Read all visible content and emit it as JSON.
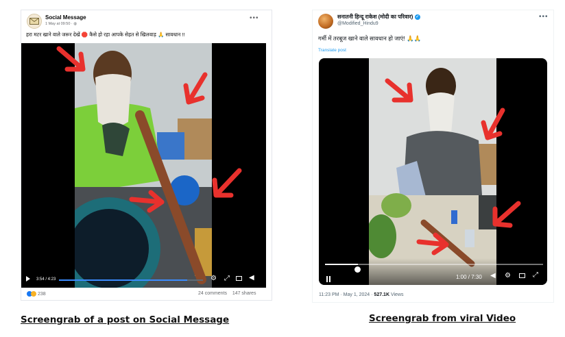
{
  "left_post": {
    "page_name": "Social Message",
    "meta": "1 May at 09:50 · ",
    "caption": "हरा मटर खाने वाले जरूर देखें 🛑 कैसे हो रहा आपके सेहत से खिलवाड़ 🙏 सावधान !!",
    "video": {
      "time_display": "3:54 / 4:23",
      "progress_fraction": 0.89
    },
    "reactions_count": "238",
    "comments": "24 comments",
    "shares": "147 shares"
  },
  "right_post": {
    "display_name": "सनातनी हिन्दू राकेश (मोदी का परिवार)",
    "handle": "@Modified_Hindu9",
    "text": "गर्मी में तरबूज खाने वाले सावधान हो जाएं! 🙏🙏",
    "translate_label": "Translate post",
    "video": {
      "time_display": "1:00 / 7:30",
      "progress_fraction": 0.15
    },
    "timestamp": "11:23 PM · May 1, 2024 · ",
    "views_count": "527.1K",
    "views_label": " Views"
  },
  "captions": {
    "left": "Screengrab  of a post on Social Message",
    "right": "Screengrab from viral Video"
  },
  "colors": {
    "arrow": "#e8312d",
    "fb_progress": "#3b8cff",
    "tw_link": "#1d9bf0",
    "verified": "#1d9bf0"
  }
}
